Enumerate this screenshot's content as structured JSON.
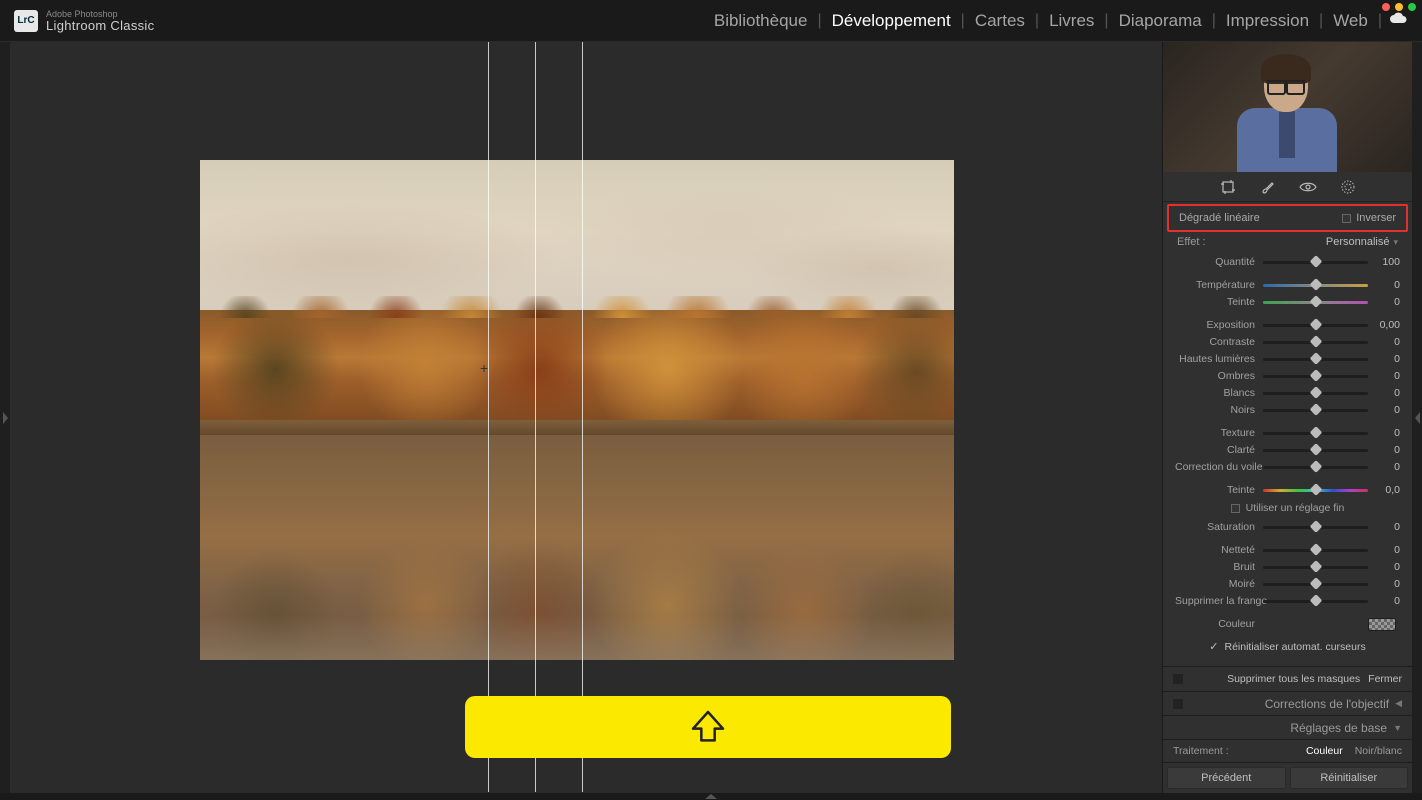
{
  "app": {
    "brand": "Adobe Photoshop",
    "name": "Lightroom Classic",
    "logo_text": "LrC"
  },
  "modules": {
    "items": [
      "Bibliothèque",
      "Développement",
      "Cartes",
      "Livres",
      "Diaporama",
      "Impression",
      "Web"
    ],
    "active_index": 1
  },
  "tools": [
    "crop-icon",
    "brush-icon",
    "eye-icon",
    "radial-icon"
  ],
  "mask": {
    "title": "Dégradé linéaire",
    "invert_label": "Inverser"
  },
  "effect": {
    "label": "Effet :",
    "value": "Personnalisé"
  },
  "sliders": {
    "amount": {
      "label": "Quantité",
      "value": "100",
      "type": "plain"
    },
    "group_wb": [
      {
        "label": "Température",
        "value": "0",
        "type": "temp"
      },
      {
        "label": "Teinte",
        "value": "0",
        "type": "tint"
      }
    ],
    "group_tone": [
      {
        "label": "Exposition",
        "value": "0,00",
        "type": "plain"
      },
      {
        "label": "Contraste",
        "value": "0",
        "type": "plain"
      },
      {
        "label": "Hautes lumières",
        "value": "0",
        "type": "plain"
      },
      {
        "label": "Ombres",
        "value": "0",
        "type": "plain"
      },
      {
        "label": "Blancs",
        "value": "0",
        "type": "plain"
      },
      {
        "label": "Noirs",
        "value": "0",
        "type": "plain"
      }
    ],
    "group_presence": [
      {
        "label": "Texture",
        "value": "0",
        "type": "plain"
      },
      {
        "label": "Clarté",
        "value": "0",
        "type": "plain"
      },
      {
        "label": "Correction du voile",
        "value": "0",
        "type": "plain"
      }
    ],
    "hue": {
      "label": "Teinte",
      "value": "0,0",
      "type": "hue"
    },
    "fine_label": "Utiliser un réglage fin",
    "saturation": {
      "label": "Saturation",
      "value": "0",
      "type": "plain"
    },
    "group_detail": [
      {
        "label": "Netteté",
        "value": "0",
        "type": "plain"
      },
      {
        "label": "Bruit",
        "value": "0",
        "type": "plain"
      },
      {
        "label": "Moiré",
        "value": "0",
        "type": "plain"
      },
      {
        "label": "Supprimer la frange",
        "value": "0",
        "type": "plain"
      }
    ],
    "color_label": "Couleur"
  },
  "reset_cursors": "Réinitialiser automat. curseurs",
  "actions": {
    "delete_all": "Supprimer tous les masques",
    "close": "Fermer"
  },
  "panels": {
    "lens": "Corrections de l'objectif",
    "basic": "Réglages de base"
  },
  "treatment": {
    "label": "Traitement :",
    "color": "Couleur",
    "bw": "Noir/blanc"
  },
  "buttons": {
    "prev": "Précédent",
    "reset": "Réinitialiser"
  }
}
